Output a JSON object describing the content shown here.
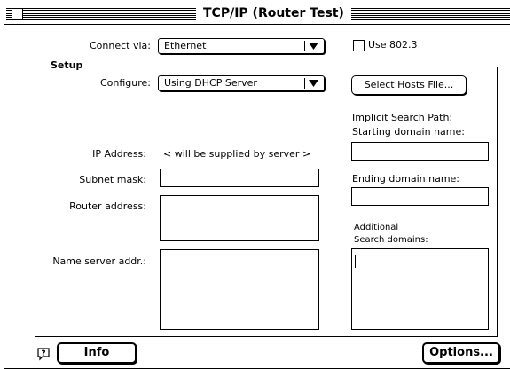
{
  "window": {
    "title": "TCP/IP (Router Test)"
  },
  "connection": {
    "connect_via_label": "Connect via:",
    "connect_via_value": "Ethernet",
    "use_8023_label": "Use 802.3",
    "use_8023_checked": false
  },
  "setup": {
    "group_title": "Setup",
    "configure_label": "Configure:",
    "configure_value": "Using DHCP Server",
    "select_hosts_button": "Select Hosts File...",
    "ip_address_label": "IP Address:",
    "ip_address_value": "< will be supplied by server >",
    "subnet_mask_label": "Subnet mask:",
    "subnet_mask_value": "",
    "router_address_label": "Router address:",
    "router_address_value": "",
    "name_server_label": "Name server addr.:",
    "name_server_value": "",
    "implicit_search_path_label": "Implicit Search Path:",
    "starting_domain_label": "Starting domain name:",
    "starting_domain_value": "",
    "ending_domain_label": "Ending domain name:",
    "ending_domain_value": "",
    "additional_label": "Additional",
    "search_domains_label": "Search domains:",
    "search_domains_value": ""
  },
  "footer": {
    "info_button": "Info",
    "options_button": "Options..."
  },
  "icons": {
    "help": "question-balloon-icon",
    "popup_arrow": "triangle-down-icon"
  }
}
